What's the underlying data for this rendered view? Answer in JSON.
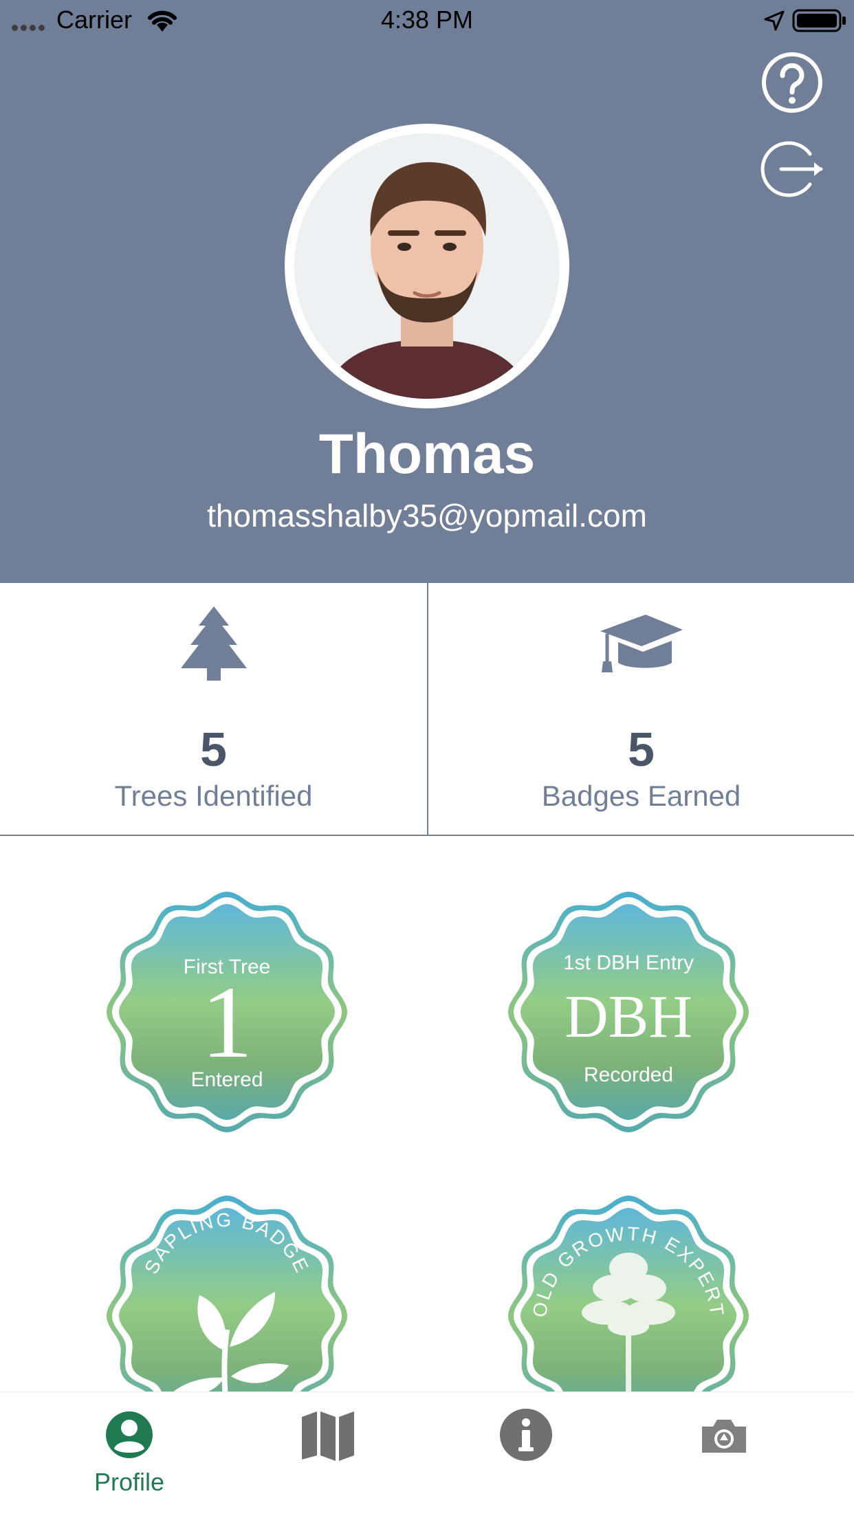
{
  "status_bar": {
    "carrier": "Carrier",
    "time": "4:38 PM",
    "icons": [
      "signal-dots",
      "wifi-icon",
      "location-arrow-icon",
      "battery-icon"
    ]
  },
  "header": {
    "background_color": "#707f97",
    "actions": [
      {
        "icon": "help-icon"
      },
      {
        "icon": "logout-icon"
      }
    ]
  },
  "profile": {
    "name": "Thomas",
    "email": "thomasshalby35@yopmail.com"
  },
  "stats": [
    {
      "icon": "tree-icon",
      "value": "5",
      "label": "Trees Identified"
    },
    {
      "icon": "graduation-cap-icon",
      "value": "5",
      "label": "Badges Earned"
    }
  ],
  "badges": [
    {
      "top": "First Tree",
      "mid": "1",
      "bottom": "Entered"
    },
    {
      "top": "1st DBH Entry",
      "mid": "DBH",
      "bottom": "Recorded"
    },
    {
      "arc": "SAPLING BADGE",
      "icon": "sapling-icon"
    },
    {
      "arc": "OLD GROWTH EXPERT",
      "icon": "tree-silhouette-icon"
    }
  ],
  "tab_bar": {
    "active_color": "#1f7a52",
    "inactive_color": "#707070",
    "tabs": [
      {
        "label": "Profile",
        "icon": "profile-icon",
        "active": true
      },
      {
        "label": "",
        "icon": "map-icon",
        "active": false
      },
      {
        "label": "",
        "icon": "info-icon",
        "active": false
      },
      {
        "label": "",
        "icon": "camera-icon",
        "active": false
      }
    ]
  }
}
